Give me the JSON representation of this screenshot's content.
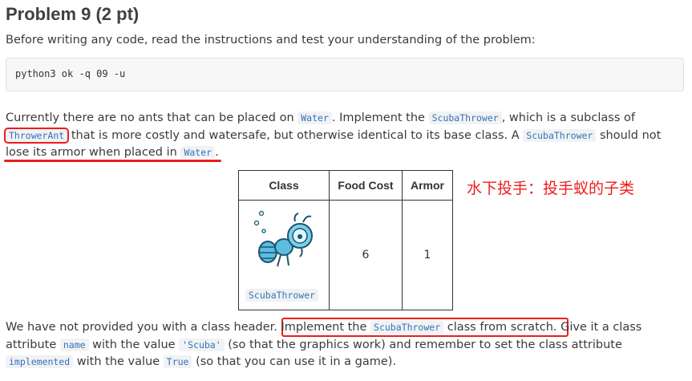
{
  "heading": "Problem 9 (2 pt)",
  "intro": "Before writing any code, read the instructions and test your understanding of the problem:",
  "command": "python3 ok -q 09 -u",
  "para1": {
    "t1": "Currently there are no ants that can be placed on ",
    "c1": "Water",
    "t2": ". Implement the ",
    "c2": "ScubaThrower",
    "t3": ", which is a subclass of ",
    "c3": "ThrowerAnt",
    "t4": " that is more costly and watersafe, but otherwise identical to its base class. A ",
    "c4": "ScubaThrower",
    "t5": " should not lose its armor when placed in ",
    "c5": "Water",
    "t6": "."
  },
  "table": {
    "headers": [
      "Class",
      "Food Cost",
      "Armor"
    ],
    "row": {
      "class_name": "ScubaThrower",
      "food_cost": "6",
      "armor": "1",
      "image": "scuba-thrower-ant-icon"
    }
  },
  "annotation": "水下投手：投手蚁的子类",
  "para2": {
    "t1": "We have not provided you with a class header. ",
    "t2": "Implement the ",
    "c1": "ScubaThrower",
    "t3": " class from scratch",
    "t4": ". Give it a class attribute ",
    "c2": "name",
    "t5": " with the value ",
    "c3": "'Scuba'",
    "t6": " (so that the graphics work) and remember to set the class attribute ",
    "c4": "implemented",
    "t7": " with the value ",
    "c5": "True",
    "t8": " (so that you can use it in a game)."
  },
  "colors": {
    "annotation_red": "#ee1c1c",
    "code_text": "#3373b8",
    "ant_body": "#5bbde0"
  }
}
